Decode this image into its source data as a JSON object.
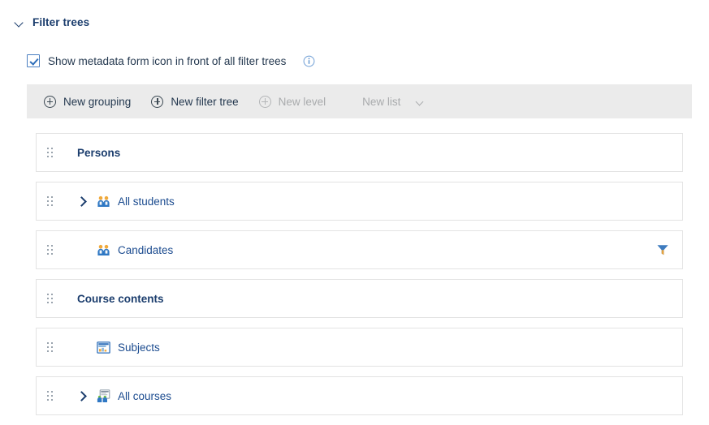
{
  "section": {
    "title": "Filter trees",
    "collapse_icon": "chevron-down-icon",
    "expanded": true
  },
  "option": {
    "checkbox_label": "Show metadata form icon in front of all filter trees",
    "checked": true,
    "info_icon": "info-circle-icon"
  },
  "toolbar": {
    "items": [
      {
        "label": "New grouping",
        "icon": "plus-circle-icon",
        "enabled": true,
        "has_chevron": false
      },
      {
        "label": "New filter tree",
        "icon": "plus-circle-icon",
        "enabled": true,
        "has_chevron": false
      },
      {
        "label": "New level",
        "icon": "plus-circle-icon",
        "enabled": false,
        "has_chevron": false
      },
      {
        "label": "New list",
        "icon": "",
        "enabled": false,
        "has_chevron": true
      }
    ]
  },
  "tree": {
    "rows": [
      {
        "label": "Persons",
        "type": "group",
        "expandable": false,
        "icon": "",
        "filter_icon": false,
        "drag_handle": "drag-handle-icon"
      },
      {
        "label": "All students",
        "type": "item",
        "expandable": true,
        "icon": "people-icon",
        "filter_icon": false,
        "drag_handle": "drag-handle-icon"
      },
      {
        "label": "Candidates",
        "type": "item",
        "expandable": false,
        "icon": "people-icon",
        "filter_icon": true,
        "drag_handle": "drag-handle-icon"
      },
      {
        "label": "Course contents",
        "type": "group",
        "expandable": false,
        "icon": "",
        "filter_icon": false,
        "drag_handle": "drag-handle-icon"
      },
      {
        "label": "Subjects",
        "type": "item",
        "expandable": false,
        "icon": "metadata-form-icon",
        "filter_icon": false,
        "drag_handle": "drag-handle-icon"
      },
      {
        "label": "All courses",
        "type": "item",
        "expandable": true,
        "icon": "metadata-form-people-icon",
        "filter_icon": false,
        "drag_handle": "drag-handle-icon"
      }
    ]
  },
  "colors": {
    "heading": "#1b3d6d",
    "link": "#1b4b8f",
    "toolbar_bg": "#ebebeb",
    "toolbar_disabled": "#a9abad",
    "row_border": "#e3e3e3",
    "accent": "#2f6fba",
    "funnel": "#3d7bbf"
  }
}
